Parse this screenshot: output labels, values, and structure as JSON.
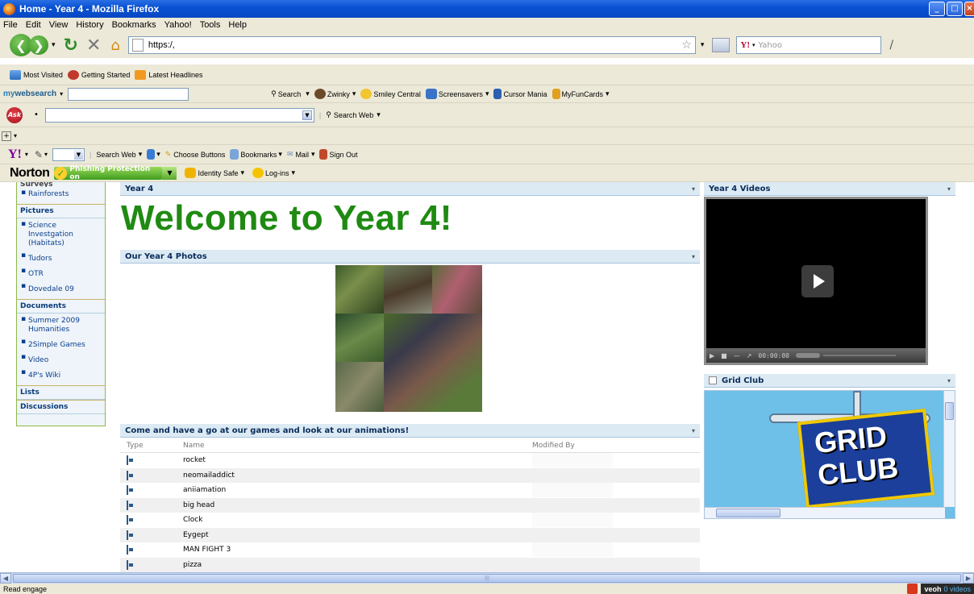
{
  "window": {
    "title": "Home - Year 4 - Mozilla Firefox",
    "controls": [
      "_",
      "□",
      "×"
    ]
  },
  "menubar": [
    "File",
    "Edit",
    "View",
    "History",
    "Bookmarks",
    "Yahoo!",
    "Tools",
    "Help"
  ],
  "navbar": {
    "url": "https:/,",
    "yahoo_placeholder": "Yahoo",
    "yahoo_logo": "Y!"
  },
  "bookmarks": [
    "Most Visited",
    "Getting Started",
    "Latest Headlines"
  ],
  "mywebsearch": {
    "logo_a": "my",
    "logo_b": "websearch",
    "search_label": "Search",
    "buttons": [
      "Zwinky",
      "Smiley Central",
      "Screensavers",
      "Cursor Mania",
      "MyFunCards"
    ]
  },
  "ask": {
    "logo": "Ask",
    "search_label": "Search Web"
  },
  "yahoo_toolbar": {
    "search_label": "Search Web",
    "choose_buttons": "Choose Buttons",
    "bookmarks": "Bookmarks",
    "mail": "Mail",
    "sign_out": "Sign Out"
  },
  "norton": {
    "logo": "Norton",
    "phishing": "Phishing Protection on",
    "identity_safe": "Identity Safe",
    "logins": "Log-ins"
  },
  "leftnav": {
    "cut_heading": "Surveys",
    "surveys_items": [
      "Rainforests"
    ],
    "pictures_heading": "Pictures",
    "pictures_items": [
      "Science Investgation (Habitats)",
      "Tudors",
      "OTR",
      "Dovedale 09"
    ],
    "documents_heading": "Documents",
    "documents_items": [
      "Summer 2009 Humanities",
      "2Simple Games",
      "Video",
      "4P's Wiki"
    ],
    "lists_heading": "Lists",
    "discussions_heading": "Discussions"
  },
  "main": {
    "header": "Year 4",
    "welcome": "Welcome to Year 4!",
    "photos_header": "Our Year 4 Photos",
    "games_header": "Come and have a go at our games and look at our animations!",
    "games_columns": [
      "Type",
      "Name",
      "Modified By"
    ],
    "games_rows": [
      "rocket",
      "neomailaddict",
      "aniiamation",
      "big head",
      "Clock",
      "Eygept",
      "MAN FIGHT 3",
      "pizza"
    ]
  },
  "sidebar": {
    "videos_header": "Year 4 Videos",
    "video_time": "00:00:00",
    "gridclub_header": "Grid Club",
    "gridclub_logo_line1": "GRID",
    "gridclub_logo_line2": "CLUB"
  },
  "statusbar": {
    "text": "Read engage",
    "veoh": "veoh",
    "veoh_videos": "0 videos"
  }
}
